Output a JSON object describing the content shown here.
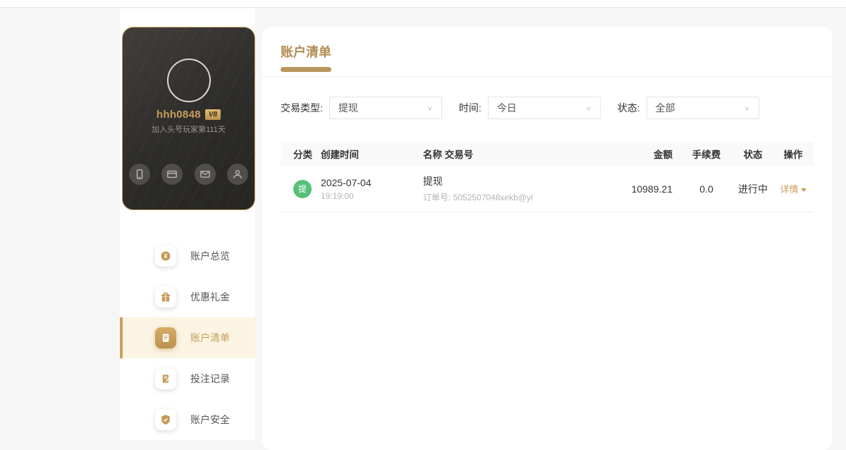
{
  "profile": {
    "username": "hhh0848",
    "vip_badge": "V8",
    "joined_text": "加入头号玩家第111天"
  },
  "sidebar": {
    "items": [
      {
        "label": "账户总览"
      },
      {
        "label": "优惠礼金"
      },
      {
        "label": "账户清单"
      },
      {
        "label": "投注记录"
      },
      {
        "label": "账户安全"
      }
    ]
  },
  "panel": {
    "title": "账户清单",
    "filters": {
      "type_label": "交易类型:",
      "type_value": "提现",
      "time_label": "时间:",
      "time_value": "今日",
      "status_label": "状态:",
      "status_value": "全部"
    },
    "table": {
      "headers": [
        "分类",
        "创建时间",
        "名称 交易号",
        "金额",
        "手续费",
        "状态",
        "操作"
      ],
      "row": {
        "badge": "提",
        "date": "2025-07-04",
        "time": "19:19:00",
        "name": "提现",
        "order": "订单号: 5052507048xekb@yl",
        "amount": "10989.21",
        "fee": "0.0",
        "status": "进行中",
        "action": "详情"
      }
    }
  },
  "colors": {
    "accent_gold": "#b8935a",
    "badge_green": "#55c077",
    "active_item_bg": "#fbf4e3"
  }
}
